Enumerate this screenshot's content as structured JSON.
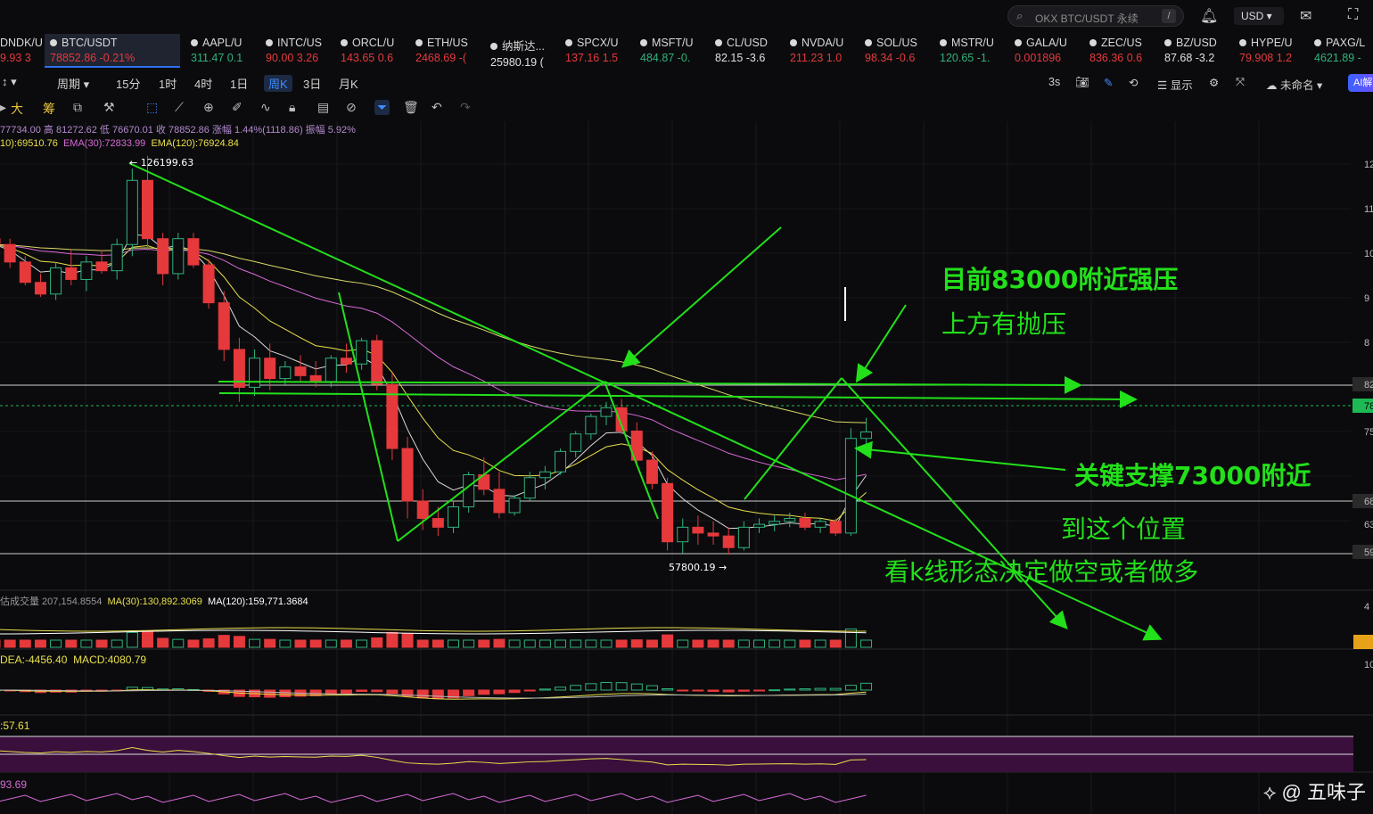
{
  "header": {
    "search_placeholder": "OKX BTC/USDT 永续",
    "search_shortcut": "/",
    "currency": "USD"
  },
  "tickers": [
    {
      "sym": "DNDK/U",
      "val": "9.93 3",
      "dir": "neg"
    },
    {
      "sym": "BTC/USDT",
      "val": "78852.86  -0.21%",
      "dir": "neg",
      "active": true
    },
    {
      "sym": "AAPL/U",
      "val": "311.47 0.1",
      "dir": "pos"
    },
    {
      "sym": "INTC/US",
      "val": "90.00 3.26",
      "dir": "neg"
    },
    {
      "sym": "ORCL/U",
      "val": "143.65 0.6",
      "dir": "neg"
    },
    {
      "sym": "ETH/US",
      "val": "2468.69 -(",
      "dir": "neg"
    },
    {
      "sym": "纳斯达...",
      "val": "25980.19 (",
      "dir": "neu"
    },
    {
      "sym": "SPCX/U",
      "val": "137.16 1.5",
      "dir": "neg"
    },
    {
      "sym": "MSFT/U",
      "val": "484.87 -0.",
      "dir": "pos"
    },
    {
      "sym": "CL/USD",
      "val": "82.15 -3.6",
      "dir": "neu"
    },
    {
      "sym": "NVDA/U",
      "val": "211.23 1.0",
      "dir": "neg"
    },
    {
      "sym": "SOL/US",
      "val": "98.34 -0.6",
      "dir": "neg"
    },
    {
      "sym": "MSTR/U",
      "val": "120.65 -1.",
      "dir": "pos"
    },
    {
      "sym": "GALA/U",
      "val": "0.001896",
      "dir": "neg"
    },
    {
      "sym": "ZEC/US",
      "val": "836.36 0.6",
      "dir": "neg"
    },
    {
      "sym": "BZ/USD",
      "val": "87.68 -3.2",
      "dir": "neu"
    },
    {
      "sym": "HYPE/U",
      "val": "79.908 1.2",
      "dir": "neg"
    },
    {
      "sym": "PAXG/L",
      "val": "4621.89 -",
      "dir": "pos"
    }
  ],
  "timeframes": [
    "周期",
    "15分",
    "1时",
    "4时",
    "1日",
    "周K",
    "3日",
    "月K"
  ],
  "selected_timeframe": "周K",
  "toolbar_right": {
    "refresh": "3s",
    "display": "显示",
    "layout": "未命名",
    "ai": "AI解"
  },
  "toolbar_cn": [
    "大",
    "筹"
  ],
  "info": {
    "ohlc": "77734.00  高 81272.62  低 76670.01  收 78852.86  涨幅 1.44%(1118.86)  振幅 5.92%",
    "ema": [
      "10):69510.76",
      "EMA(30):72833.99",
      "EMA(120):76924.84"
    ],
    "vol": [
      "估成交量 207,154.8554",
      "MA(30):130,892.3069",
      "MA(120):159,771.3684"
    ],
    "macd": [
      "DEA:-4456.40",
      "MACD:4080.79"
    ],
    "ind3": ":57.61",
    "ind4": "93.69"
  },
  "annotations": {
    "high": "← 126199.63",
    "low": "57800.19 →",
    "text1": "目前83000附近强压",
    "text2": "上方有抛压",
    "text3": "关键支撑73000附近",
    "text4": "到这个位置",
    "text5": "看k线形态决定做空或者做多"
  },
  "axis_labels": [
    "12",
    "11",
    "10",
    "9",
    "8",
    "82",
    "78",
    "75",
    "68",
    "63",
    "59",
    "4",
    "10"
  ],
  "credit": "@ 五味子",
  "colors": {
    "up": "#2fb37c",
    "down": "#e5393c",
    "annot": "#22e01a",
    "price": "#1db954",
    "accent": "#3e8cff"
  },
  "chart_data": {
    "type": "candlestick",
    "price_high": 126199.63,
    "price_low": 57800.19,
    "ylim": [
      52000,
      130000
    ],
    "resistance": 83000,
    "support": 73000,
    "last_close": 78852.86,
    "candles": [
      [
        112000,
        114000,
        109000,
        111000
      ],
      [
        111000,
        112000,
        107000,
        108000
      ],
      [
        108000,
        109000,
        104000,
        104500
      ],
      [
        104500,
        106000,
        102000,
        102500
      ],
      [
        102500,
        108000,
        101500,
        107000
      ],
      [
        107000,
        110000,
        104000,
        105000
      ],
      [
        105000,
        109000,
        103000,
        108000
      ],
      [
        108000,
        110000,
        106000,
        106500
      ],
      [
        106500,
        112000,
        105000,
        111000
      ],
      [
        111000,
        124000,
        109000,
        122000
      ],
      [
        122000,
        126199.63,
        110000,
        112000
      ],
      [
        112000,
        113000,
        104000,
        106000
      ],
      [
        106000,
        113000,
        105000,
        112000
      ],
      [
        112000,
        113000,
        107000,
        107500
      ],
      [
        107500,
        108500,
        100000,
        101000
      ],
      [
        101000,
        103000,
        91000,
        93000
      ],
      [
        93000,
        95000,
        84000,
        86500
      ],
      [
        86500,
        93000,
        85000,
        91500
      ],
      [
        91500,
        94000,
        86000,
        88000
      ],
      [
        88000,
        91000,
        87000,
        90000
      ],
      [
        90000,
        92000,
        87500,
        88500
      ],
      [
        88500,
        91000,
        86500,
        87500
      ],
      [
        87500,
        92000,
        86500,
        91500
      ],
      [
        91500,
        94000,
        89000,
        90500
      ],
      [
        90500,
        95000,
        89500,
        94500
      ],
      [
        94500,
        95500,
        86000,
        87000
      ],
      [
        87000,
        89000,
        74000,
        76000
      ],
      [
        76000,
        78000,
        64000,
        67000
      ],
      [
        67000,
        69000,
        62000,
        64000
      ],
      [
        64000,
        66000,
        61000,
        62500
      ],
      [
        62500,
        67000,
        61500,
        66000
      ],
      [
        66000,
        72000,
        65000,
        71500
      ],
      [
        71500,
        74500,
        68000,
        69000
      ],
      [
        69000,
        72000,
        64000,
        65000
      ],
      [
        65000,
        68000,
        64500,
        67500
      ],
      [
        67500,
        72000,
        67000,
        71000
      ],
      [
        71000,
        73000,
        69000,
        72000
      ],
      [
        72000,
        76000,
        71500,
        75500
      ],
      [
        75500,
        79000,
        74500,
        78500
      ],
      [
        78500,
        82000,
        77500,
        81500
      ],
      [
        81500,
        84000,
        80000,
        83000
      ],
      [
        83000,
        84500,
        78500,
        79000
      ],
      [
        79000,
        80500,
        73000,
        74000
      ],
      [
        74000,
        75500,
        69000,
        70000
      ],
      [
        70000,
        71000,
        58500,
        60000
      ],
      [
        60000,
        64000,
        58000,
        62500
      ],
      [
        62500,
        64500,
        59500,
        61500
      ],
      [
        61500,
        63500,
        59500,
        61000
      ],
      [
        61000,
        62500,
        57800.19,
        59000
      ],
      [
        59000,
        63500,
        58500,
        62500
      ],
      [
        62500,
        64000,
        61500,
        63000
      ],
      [
        63000,
        64500,
        61800,
        63500
      ],
      [
        63500,
        65000,
        62500,
        64000
      ],
      [
        64000,
        65000,
        62000,
        62500
      ],
      [
        62500,
        64000,
        61500,
        63500
      ],
      [
        63500,
        64000,
        61000,
        61500
      ],
      [
        61500,
        79500,
        61000,
        77734
      ],
      [
        77734,
        81272.62,
        76670.01,
        78852.86
      ]
    ]
  }
}
